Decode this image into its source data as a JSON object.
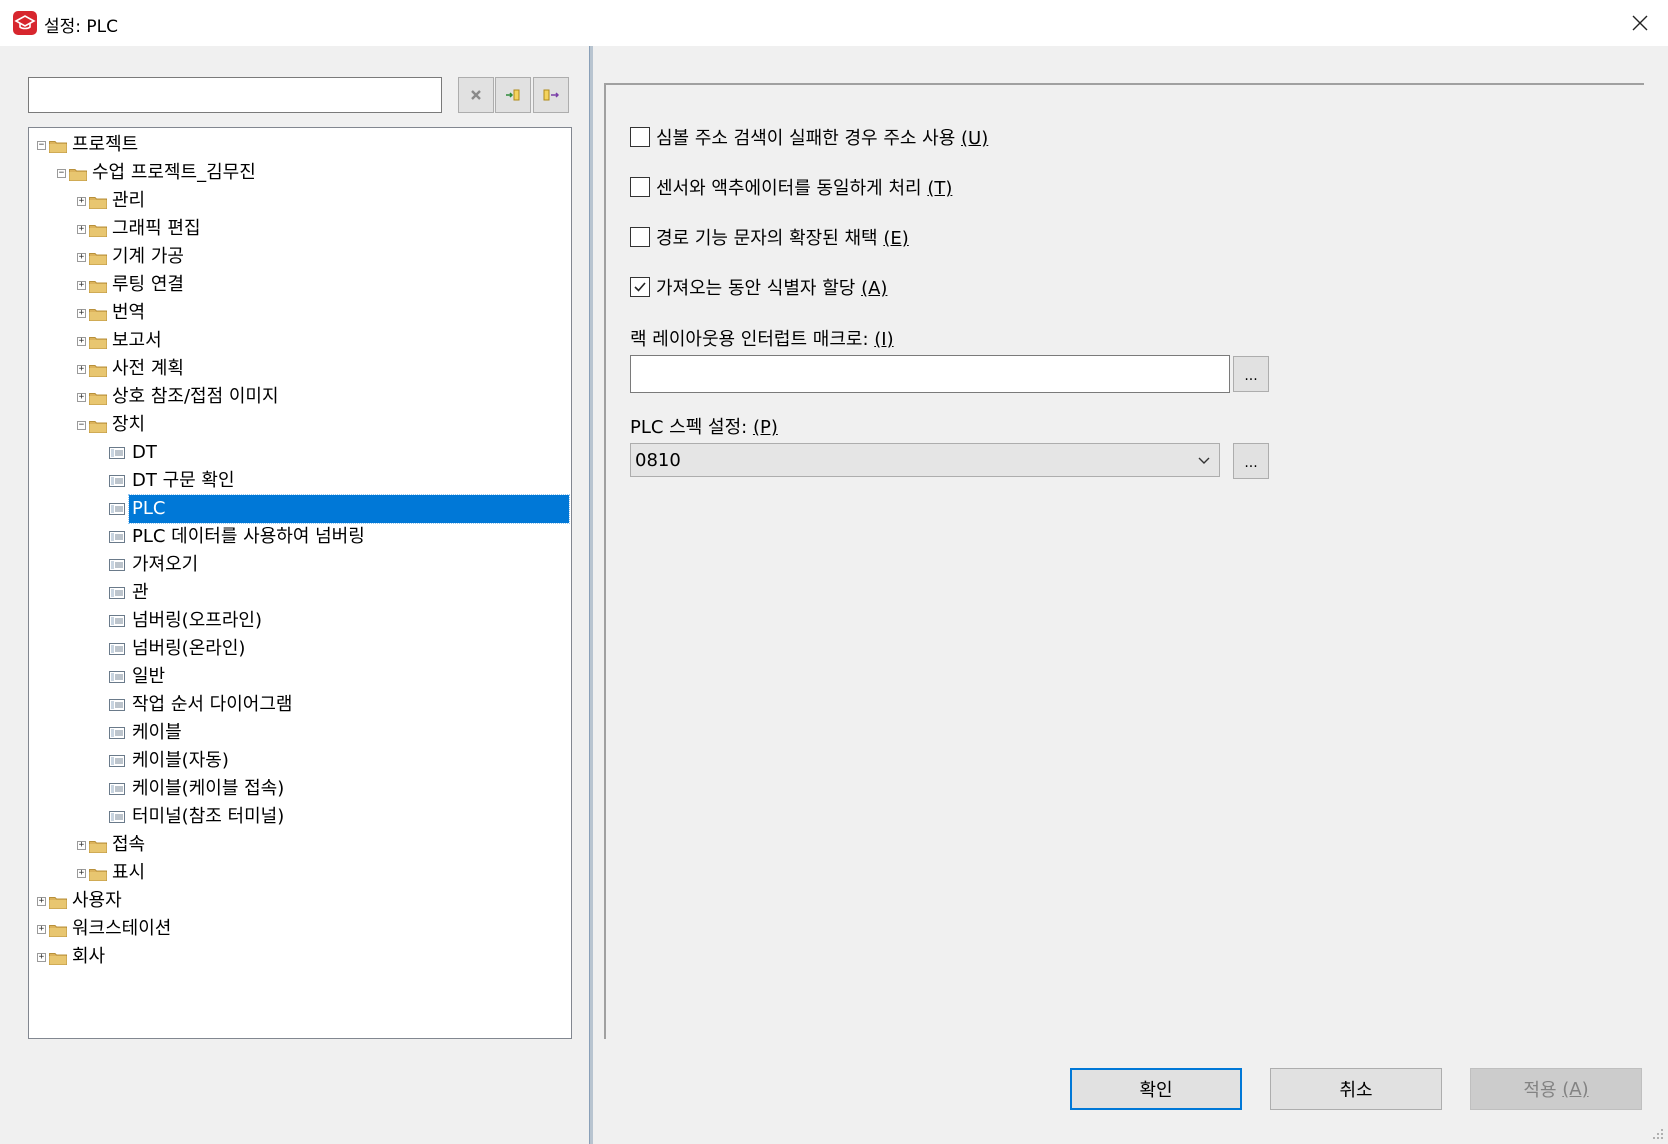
{
  "window": {
    "title": "설정: PLC",
    "app_icon": "graduation-cap-icon"
  },
  "search": {
    "value": "",
    "placeholder": ""
  },
  "toolbar": {
    "clear_icon": "clear-x-icon",
    "expand_icon": "expand-tree-icon",
    "collapse_icon": "collapse-tree-icon"
  },
  "tree": {
    "root_project": "프로젝트",
    "project_name": "수업 프로젝트_김무진",
    "folders_top": [
      "관리",
      "그래픽 편집",
      "기계 가공",
      "루팅 연결",
      "번역",
      "보고서",
      "사전 계획",
      "상호 참조/접점 이미지"
    ],
    "device_folder": "장치",
    "device_items": [
      "DT",
      "DT 구문 확인",
      "PLC",
      "PLC 데이터를 사용하여 넘버링",
      "가져오기",
      "관",
      "넘버링(오프라인)",
      "넘버링(온라인)",
      "일반",
      "작업 순서 다이어그램",
      "케이블",
      "케이블(자동)",
      "케이블(케이블 접속)",
      "터미널(참조 터미널)"
    ],
    "selected_item": "PLC",
    "folders_bottom": [
      "접속",
      "표시"
    ],
    "roots_bottom": [
      "사용자",
      "워크스테이션",
      "회사"
    ]
  },
  "options": {
    "checkbox1": {
      "label": "심볼 주소 검색이 실패한 경우 주소 사용",
      "key": "(U)",
      "checked": false
    },
    "checkbox2": {
      "label": "센서와 액추에이터를 동일하게 처리",
      "key": "(T)",
      "checked": false
    },
    "checkbox3": {
      "label": "경로 기능 문자의 확장된 채택",
      "key": "(E)",
      "checked": false
    },
    "checkbox4": {
      "label": "가져오는 동안 식별자 할당",
      "key": "(A)",
      "checked": true
    },
    "rack_macro_label": "랙 레이아웃용 인터럽트 매크로:",
    "rack_macro_key": "(I)",
    "rack_macro_value": "",
    "plc_spec_label": "PLC 스펙 설정:",
    "plc_spec_key": "(P)",
    "plc_spec_value": "0810",
    "ellipsis": "..."
  },
  "buttons": {
    "ok": "확인",
    "cancel": "취소",
    "apply": "적용",
    "apply_key": "(A)"
  },
  "colors": {
    "selection": "#0078d7",
    "brand": "#d7262e",
    "folder": "#dcb35c"
  }
}
